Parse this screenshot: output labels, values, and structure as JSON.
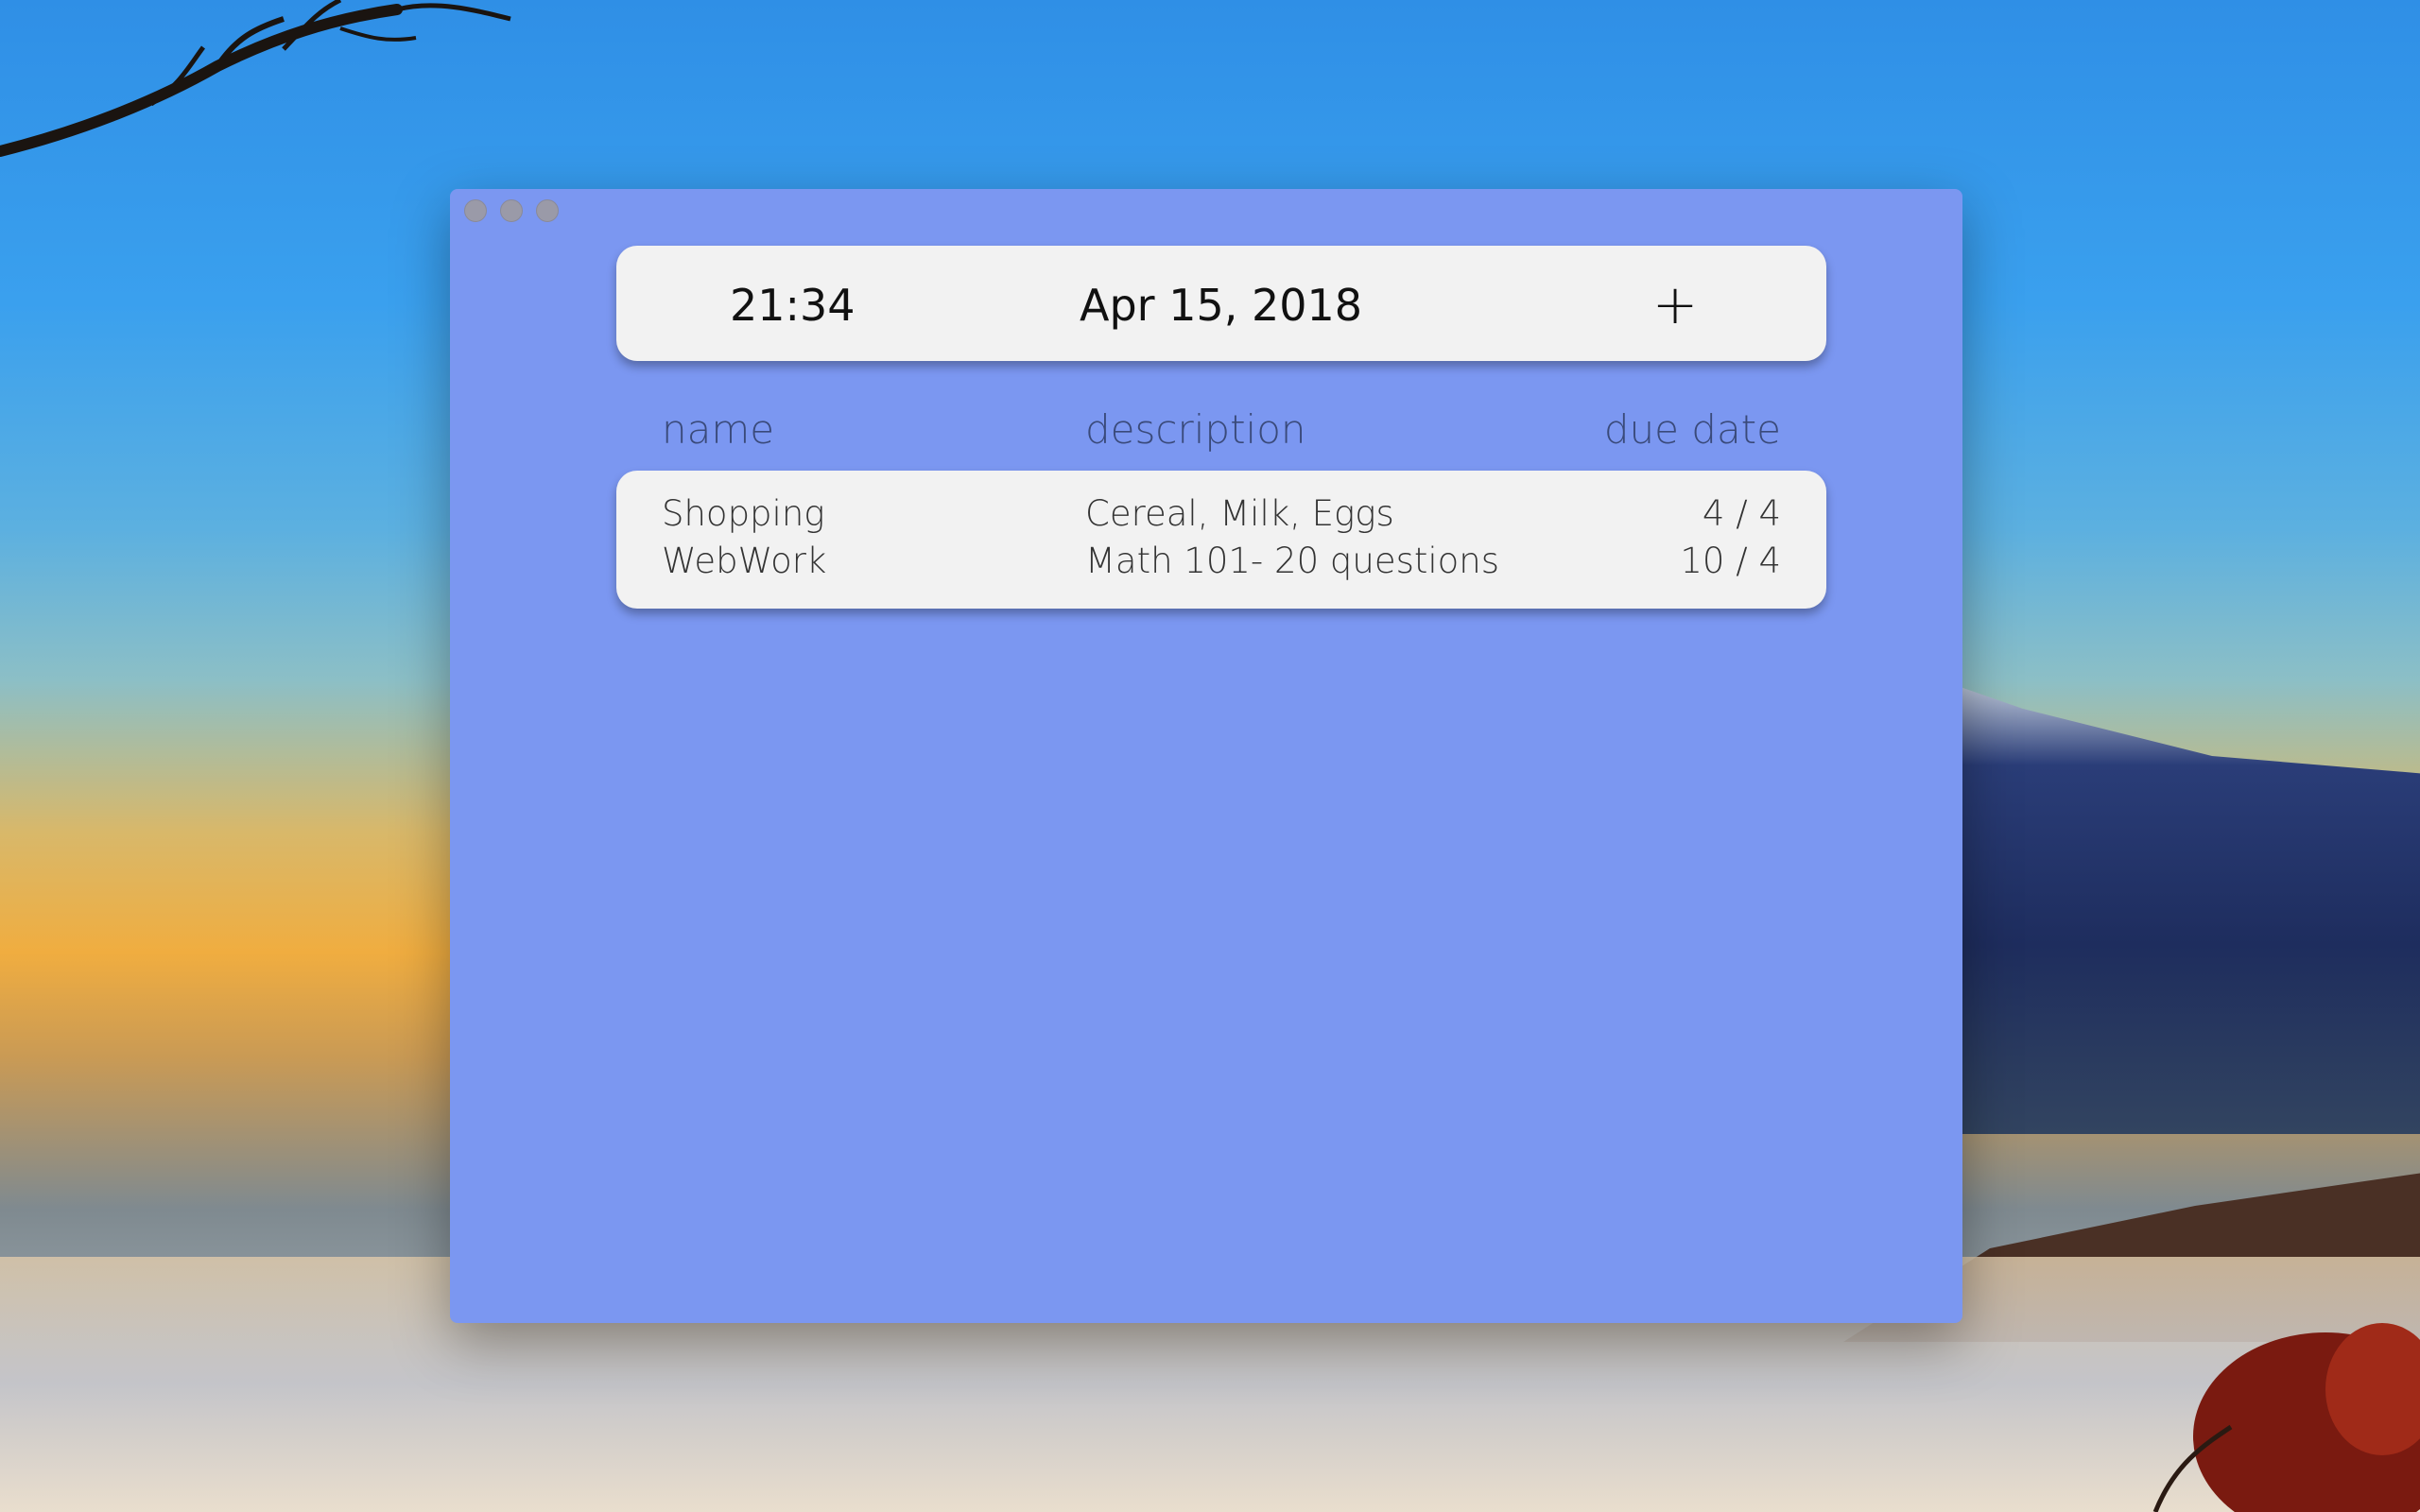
{
  "app": {
    "header": {
      "time": "21:34",
      "date": "Apr 15, 2018",
      "add_label": "+"
    },
    "columns": {
      "name": "name",
      "description": "description",
      "due_date": "due date"
    },
    "tasks": [
      {
        "name": "Shopping",
        "description": "Cereal, Milk, Eggs",
        "due": "4 / 4"
      },
      {
        "name": "WebWork",
        "description": "Math 101- 20 questions",
        "due": "10 / 4"
      }
    ]
  },
  "colors": {
    "window_bg": "#7b97f1",
    "card_bg": "#f2f2f2",
    "traffic_light": "#9a9aa8"
  }
}
